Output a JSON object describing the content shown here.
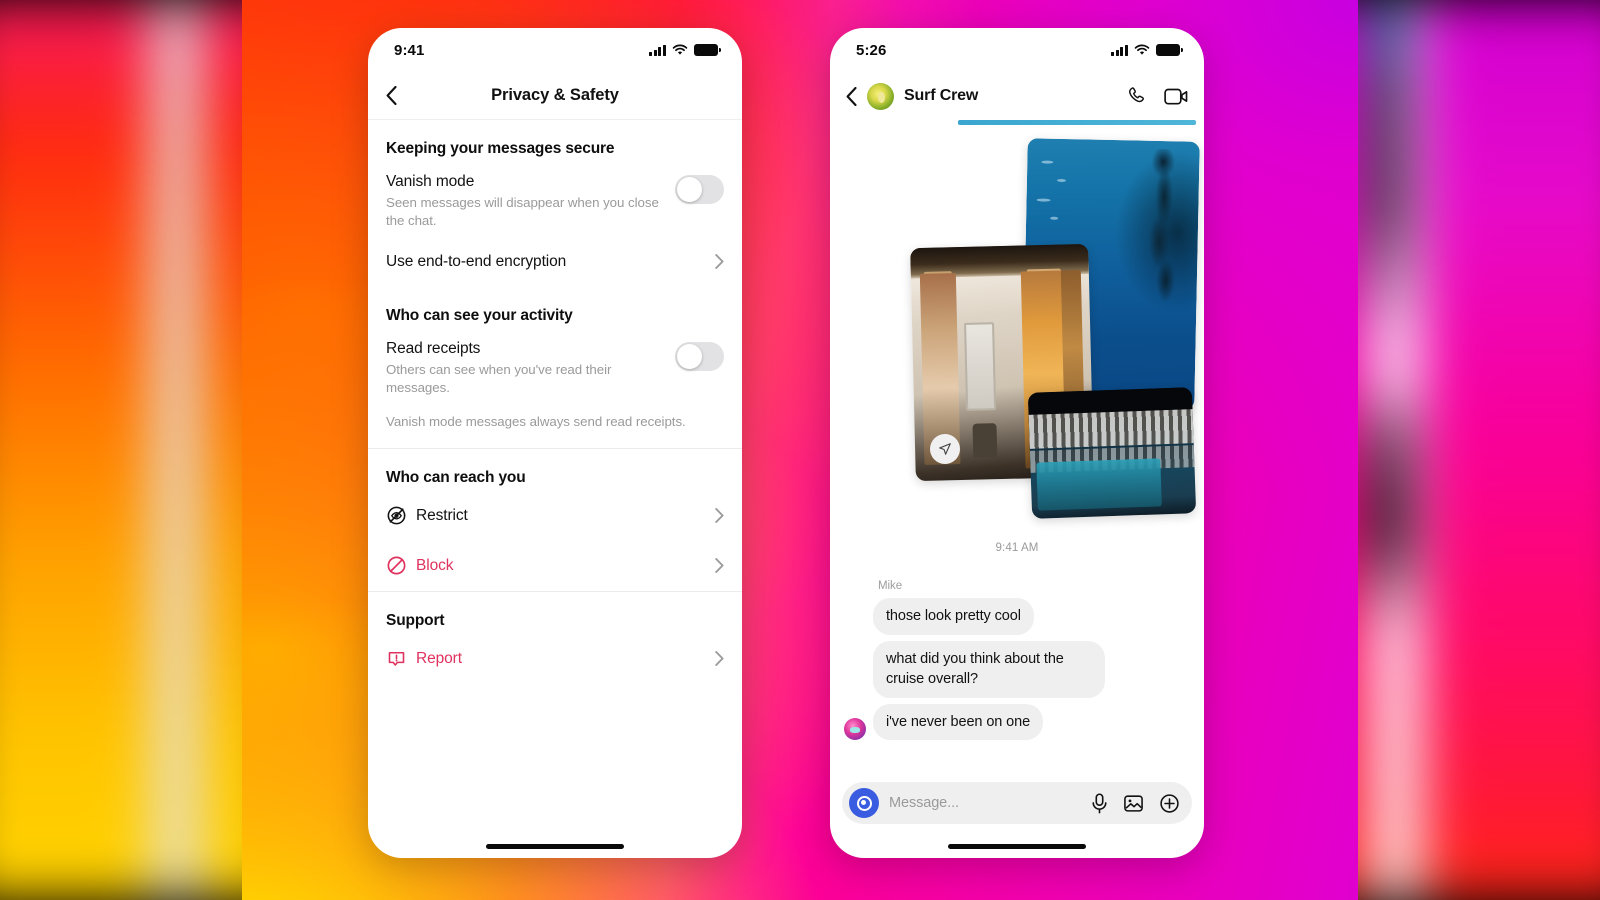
{
  "scene": {
    "description": "Two iPhone mockups on a pink-orange gradient marketing background"
  },
  "phone_left": {
    "status_bar": {
      "time": "9:41",
      "signal_icon": "cellular-bars-icon",
      "wifi_icon": "wifi-icon",
      "battery_icon": "battery-full-icon"
    },
    "nav": {
      "back_icon": "chevron-left-icon",
      "title": "Privacy & Safety"
    },
    "sections": [
      {
        "title": "Keeping your messages secure",
        "rows": [
          {
            "type": "toggle",
            "label": "Vanish mode",
            "sub": "Seen messages will disappear when you close the chat.",
            "state": "off"
          },
          {
            "type": "link",
            "label": "Use end-to-end encryption",
            "icon": "chevron-right-icon"
          }
        ]
      },
      {
        "title": "Who can see your activity",
        "rows": [
          {
            "type": "toggle",
            "label": "Read receipts",
            "sub": "Others can see when you've read their messages.",
            "state": "off"
          }
        ],
        "note": "Vanish mode messages always send read receipts."
      },
      {
        "title": "Who can reach you",
        "rows": [
          {
            "type": "link",
            "label": "Restrict",
            "icon": "restrict-eye-slash-icon",
            "tone": "neutral"
          },
          {
            "type": "link",
            "label": "Block",
            "icon": "block-circle-slash-icon",
            "tone": "danger"
          }
        ]
      },
      {
        "title": "Support",
        "rows": [
          {
            "type": "link",
            "label": "Report",
            "icon": "report-bubble-exclamation-icon",
            "tone": "danger"
          }
        ]
      }
    ],
    "home_indicator": "home-indicator"
  },
  "phone_right": {
    "status_bar": {
      "time": "5:26",
      "signal_icon": "cellular-bars-icon",
      "wifi_icon": "wifi-icon",
      "battery_icon": "battery-full-icon"
    },
    "nav": {
      "back_icon": "chevron-left-icon",
      "avatar": "group-avatar-avocado",
      "title": "Surf Crew",
      "call_icon": "phone-call-icon",
      "video_icon": "video-camera-icon"
    },
    "attachments": {
      "share_icon": "share-paperplane-icon",
      "photos": [
        {
          "name": "ocean-diver-photo",
          "alt": "underwater diver in blue ocean"
        },
        {
          "name": "interior-room-photo",
          "alt": "room with columns and orange curtains"
        },
        {
          "name": "pool-night-photo",
          "alt": "cruise ship pool deck at night"
        }
      ]
    },
    "timestamp": "9:41 AM",
    "sender_label": "Mike",
    "messages": [
      {
        "text": "those look pretty cool",
        "avatar": false
      },
      {
        "text": "what did you think about the cruise overall?",
        "avatar": false
      },
      {
        "text": "i've never been on one",
        "avatar": true,
        "avatar_name": "mike-avatar"
      }
    ],
    "composer": {
      "camera_icon": "camera-circle-icon",
      "placeholder": "Message...",
      "mic_icon": "microphone-icon",
      "gallery_icon": "photo-gallery-icon",
      "plus_icon": "plus-circle-icon"
    },
    "home_indicator": "home-indicator"
  },
  "colors": {
    "danger": "#e0325f",
    "muted": "#9a9a9a",
    "bubble": "#efefef",
    "toggle_track": "#e2e2e4",
    "camera_blue": "#3a5ce0"
  }
}
